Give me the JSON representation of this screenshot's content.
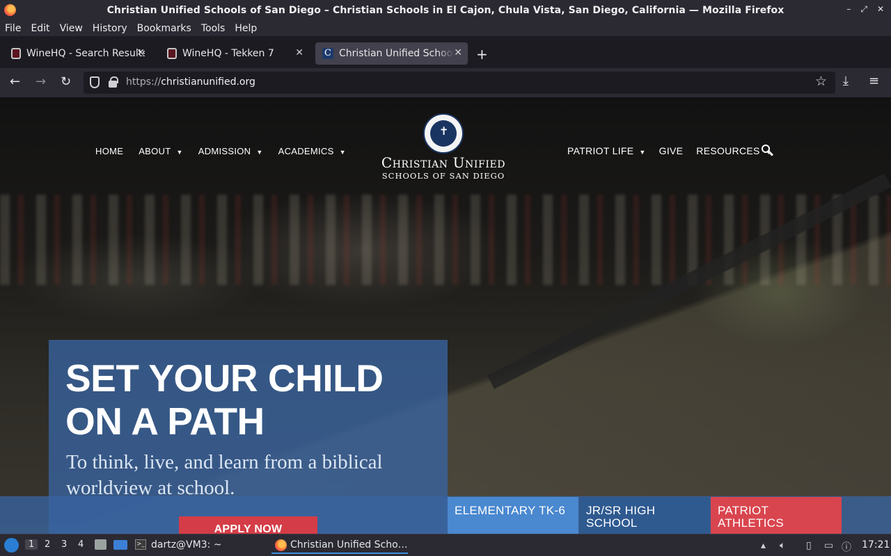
{
  "window": {
    "title": "Christian Unified Schools of San Diego – Christian Schools in El Cajon, Chula Vista, San Diego, California — Mozilla Firefox",
    "controls": {
      "minimize": "–",
      "maximize": "⤢",
      "close": "✕"
    }
  },
  "menu": [
    "File",
    "Edit",
    "View",
    "History",
    "Bookmarks",
    "Tools",
    "Help"
  ],
  "tabs": [
    {
      "label": "WineHQ - Search Results",
      "icon": "winehq-favicon",
      "active": false
    },
    {
      "label": "WineHQ - Tekken 7",
      "icon": "winehq-favicon",
      "active": false
    },
    {
      "label": "Christian Unified Schools",
      "icon": "christian-unified-favicon",
      "active": true
    }
  ],
  "tab_close_glyph": "✕",
  "new_tab_glyph": "+",
  "nav": {
    "back_glyph": "←",
    "forward_glyph": "→",
    "reload_glyph": "↻",
    "url_prefix": "https://",
    "url_host": "christianunified.org",
    "bookmark_glyph": "☆",
    "download_glyph": "⤓",
    "menu_glyph": "≡"
  },
  "site": {
    "nav_left": [
      "HOME",
      "ABOUT",
      "ADMISSION",
      "ACADEMICS"
    ],
    "nav_right": [
      "PATRIOT LIFE",
      "GIVE",
      "RESOURCES"
    ],
    "caret": "▼",
    "logo_name": "Christian Unified",
    "logo_sub": "SCHOOLS OF SAN DIEGO",
    "hero_heading": "SET YOUR CHILD ON A PATH",
    "hero_sub": "To think, live, and learn from a biblical worldview at school.",
    "apply_label": "APPLY NOW",
    "cta": {
      "elementary": "ELEMENTARY TK-6",
      "jrsr": "JR/SR HIGH SCHOOL",
      "athletics": "PATRIOT ATHLETICS"
    },
    "colors": {
      "brand_blue": "#2f5a90",
      "light_blue": "#4a88d0",
      "red": "#d9454e"
    }
  },
  "taskbar": {
    "workspaces": [
      "1",
      "2",
      "3",
      "4"
    ],
    "terminal_task": "dartz@VM3: ~",
    "firefox_task": "Christian Unified Scho…",
    "clock": "17:21"
  }
}
